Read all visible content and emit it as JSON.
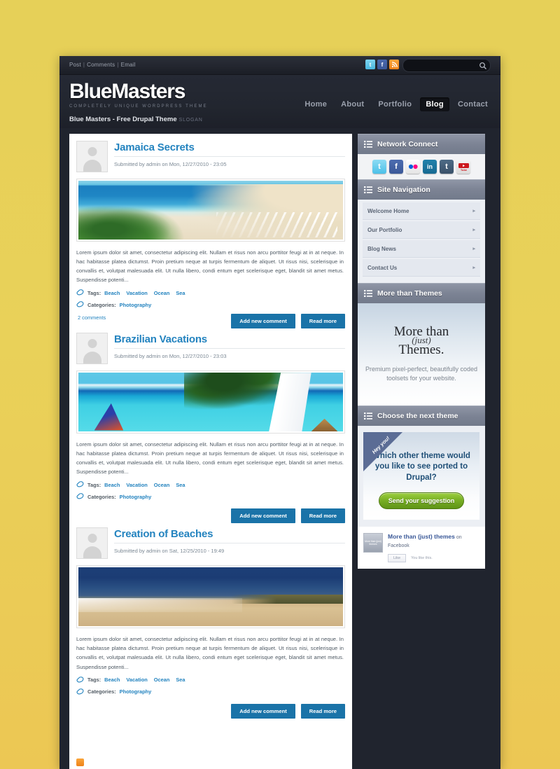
{
  "utility": {
    "links": [
      "Post",
      "Comments",
      "Email"
    ],
    "separator": "|",
    "social": [
      "twitter-icon",
      "facebook-icon",
      "rss-icon"
    ],
    "search_placeholder": "",
    "search_value": ""
  },
  "header": {
    "logo_part1": "Blue",
    "logo_part2": "Masters",
    "logo_sub": "COMPLETELY UNIQUE WORDPRESS THEME",
    "site_name": "Blue Masters - Free Drupal Theme",
    "slogan": "SLOGAN",
    "nav": [
      {
        "label": "Home",
        "active": false
      },
      {
        "label": "About",
        "active": false
      },
      {
        "label": "Portfolio",
        "active": false
      },
      {
        "label": "Blog",
        "active": true
      },
      {
        "label": "Contact",
        "active": false
      }
    ]
  },
  "posts": [
    {
      "title": "Jamaica Secrets",
      "submitted": "Submitted by admin on Mon, 12/27/2010 - 23:05",
      "image": "jamaica-beach-photo",
      "body": "Lorem ipsum dolor sit amet, consectetur adipiscing elit. Nullam et risus non arcu porttitor feugi at in at neque. In hac habitasse platea dictumst. Proin pretium neque at turpis fermentum de aliquet. Ut risus nisi, scelerisque in convallis et, volutpat malesuada elit. Ut nulla libero, condi entum eget scelerisque eget, blandit sit amet metus. Suspendisse potenti...",
      "tags_label": "Tags:",
      "tags": [
        "Beach",
        "Vacation",
        "Ocean",
        "Sea"
      ],
      "categories_label": "Categories:",
      "categories": [
        "Photography"
      ],
      "comments": "2 comments",
      "add_comment": "Add new comment",
      "read_more": "Read more"
    },
    {
      "title": "Brazilian Vacations",
      "submitted": "Submitted by admin on Mon, 12/27/2010 - 23:03",
      "image": "brazil-palm-sail-photo",
      "body": "Lorem ipsum dolor sit amet, consectetur adipiscing elit. Nullam et risus non arcu porttitor feugi at in at neque. In hac habitasse platea dictumst. Proin pretium neque at turpis fermentum de aliquet. Ut risus nisi, scelerisque in convallis et, volutpat malesuada elit. Ut nulla libero, condi entum eget scelerisque eget, blandit sit amet metus. Suspendisse potenti...",
      "tags_label": "Tags:",
      "tags": [
        "Beach",
        "Vacation",
        "Ocean",
        "Sea"
      ],
      "categories_label": "Categories:",
      "categories": [
        "Photography"
      ],
      "comments": "",
      "add_comment": "Add new comment",
      "read_more": "Read more"
    },
    {
      "title": "Creation of Beaches",
      "submitted": "Submitted by admin on Sat, 12/25/2010 - 19:49",
      "image": "dark-sky-beach-photo",
      "body": "Lorem ipsum dolor sit amet, consectetur adipiscing elit. Nullam et risus non arcu porttitor feugi at in at neque. In hac habitasse platea dictumst. Proin pretium neque at turpis fermentum de aliquet. Ut risus nisi, scelerisque in convallis et, volutpat malesuada elit. Ut nulla libero, condi entum eget scelerisque eget, blandit sit amet metus. Suspendisse potenti...",
      "tags_label": "Tags:",
      "tags": [
        "Beach",
        "Vacation",
        "Ocean",
        "Sea"
      ],
      "categories_label": "Categories:",
      "categories": [
        "Photography"
      ],
      "comments": "",
      "add_comment": "Add new comment",
      "read_more": "Read more"
    }
  ],
  "sidebar": {
    "network_connect": {
      "title": "Network Connect",
      "icons": [
        "twitter-icon",
        "facebook-icon",
        "flickr-icon",
        "linkedin-icon",
        "tumblr-icon",
        "youtube-icon"
      ],
      "glyphs": [
        "t",
        "f",
        "••",
        "in",
        "t",
        "You Tube"
      ]
    },
    "site_navigation": {
      "title": "Site Navigation",
      "items": [
        "Welcome Home",
        "Our Portfolio",
        "Blog News",
        "Contact Us"
      ],
      "arrow": "▸"
    },
    "more_than_themes": {
      "title": "More than Themes",
      "logo_line1": "More than",
      "logo_just": "(just)",
      "logo_line2": "Themes.",
      "tagline": "Premium pixel-perfect, beautifully coded toolsets for your website."
    },
    "choose_theme": {
      "title": "Choose the next theme",
      "ribbon": "Hey you!",
      "question": "Which other theme would you like to see ported to Drupal?",
      "button": "Send your suggestion"
    },
    "facebook_box": {
      "thumb_text": "More than (just) themes",
      "name": "More than (just) themes",
      "suffix": " on Facebook",
      "like_button": "Like",
      "like_text": "You like this."
    }
  },
  "footer": {
    "rss": "rss-icon"
  },
  "colors": {
    "page_bg": "#e9d159",
    "frame": "#20242e",
    "accent_blue": "#2383bf",
    "button_blue": "#1a73a8",
    "widget_header": "#7c8394",
    "green_button": "#79b025"
  }
}
